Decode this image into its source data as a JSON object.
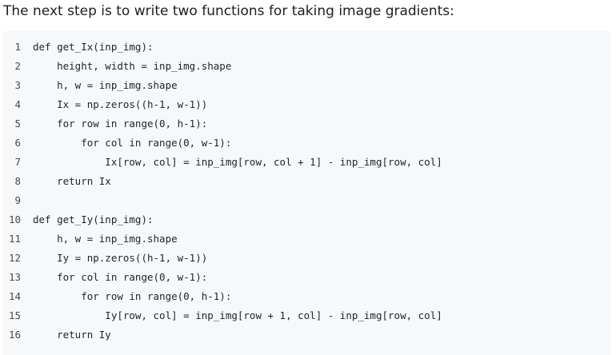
{
  "intro_text": "The next step is to write two functions for taking image gradients:",
  "code": {
    "lines": [
      {
        "n": "1",
        "text": "def get_Ix(inp_img):"
      },
      {
        "n": "2",
        "text": "    height, width = inp_img.shape"
      },
      {
        "n": "3",
        "text": "    h, w = inp_img.shape"
      },
      {
        "n": "4",
        "text": "    Ix = np.zeros((h-1, w-1))"
      },
      {
        "n": "5",
        "text": "    for row in range(0, h-1):"
      },
      {
        "n": "6",
        "text": "        for col in range(0, w-1):"
      },
      {
        "n": "7",
        "text": "            Ix[row, col] = inp_img[row, col + 1] - inp_img[row, col]"
      },
      {
        "n": "8",
        "text": "    return Ix"
      },
      {
        "n": "9",
        "text": ""
      },
      {
        "n": "10",
        "text": "def get_Iy(inp_img):"
      },
      {
        "n": "11",
        "text": "    h, w = inp_img.shape"
      },
      {
        "n": "12",
        "text": "    Iy = np.zeros((h-1, w-1))"
      },
      {
        "n": "13",
        "text": "    for col in range(0, w-1):"
      },
      {
        "n": "14",
        "text": "        for row in range(0, h-1):"
      },
      {
        "n": "15",
        "text": "            Iy[row, col] = inp_img[row + 1, col] - inp_img[row, col]"
      },
      {
        "n": "16",
        "text": "    return Iy"
      }
    ]
  }
}
